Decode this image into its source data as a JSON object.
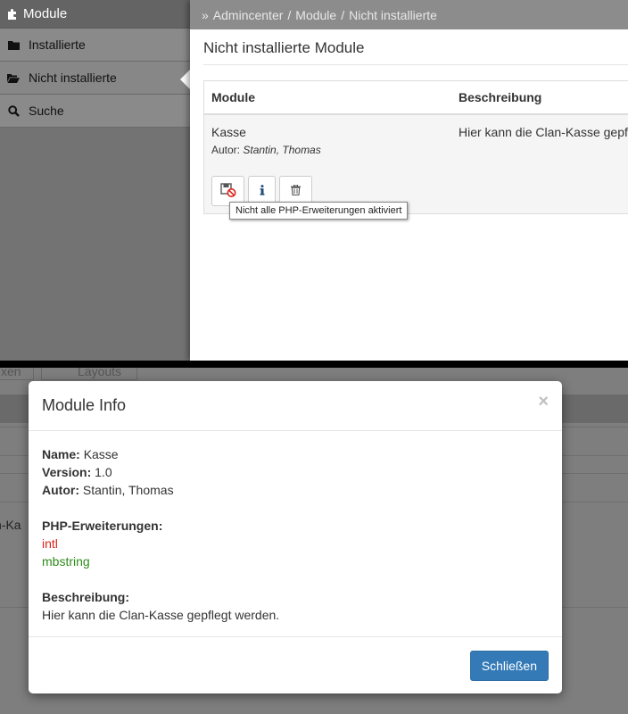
{
  "sidebar": {
    "title": "Module",
    "items": [
      {
        "label": "Installierte",
        "icon": "folder-icon"
      },
      {
        "label": "Nicht installierte",
        "icon": "folder-open-icon"
      },
      {
        "label": "Suche",
        "icon": "search-icon"
      }
    ]
  },
  "breadcrumb": {
    "prefix": "»",
    "items": [
      "Admincenter",
      "Module",
      "Nicht installierte"
    ]
  },
  "main": {
    "title": "Nicht installierte Module",
    "table": {
      "columns": [
        "Module",
        "Beschreibung"
      ],
      "rows": [
        {
          "name": "Kasse",
          "author_prefix": "Autor:",
          "author": "Stantin, Thomas",
          "description": "Hier kann die Clan-Kasse gepf"
        }
      ]
    },
    "tooltip": "Nicht alle PHP-Erweiterungen aktiviert"
  },
  "background": {
    "tab1": "xen",
    "tab2": "Layouts",
    "row_text": "n-Ka"
  },
  "modal": {
    "title": "Module Info",
    "close": "×",
    "name_label": "Name:",
    "name": "Kasse",
    "version_label": "Version:",
    "version": "1.0",
    "author_label": "Autor:",
    "author": "Stantin, Thomas",
    "ext_label": "PHP-Erweiterungen:",
    "extensions": [
      {
        "name": "intl",
        "status": "missing",
        "color": "#d9251c"
      },
      {
        "name": "mbstring",
        "status": "ok",
        "color": "#2e8b1a"
      }
    ],
    "desc_label": "Beschreibung:",
    "description": "Hier kann die Clan-Kasse gepflegt werden.",
    "close_button": "Schließen"
  },
  "colors": {
    "primary": "#337ab7",
    "error": "#d9251c",
    "success": "#2e8b1a"
  }
}
